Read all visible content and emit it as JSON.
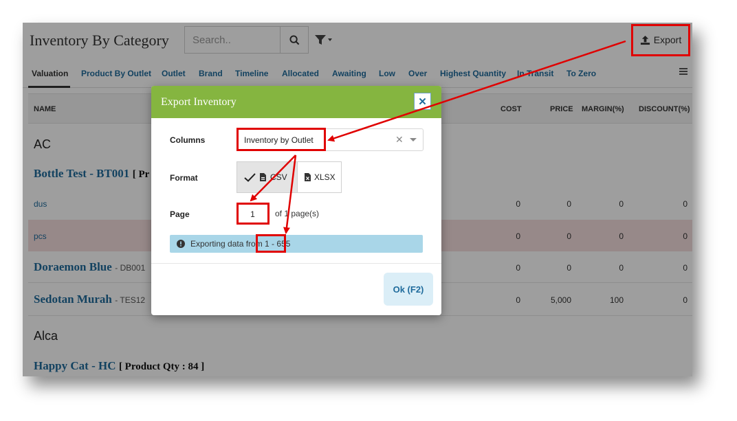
{
  "header": {
    "title": "Inventory By Category",
    "search_placeholder": "Search..",
    "export_label": "Export"
  },
  "tabs": [
    {
      "label": "Valuation",
      "active": true
    },
    {
      "label": "Product By Outlet"
    },
    {
      "label": "Outlet"
    },
    {
      "label": "Brand"
    },
    {
      "label": "Timeline"
    },
    {
      "label": "Allocated"
    },
    {
      "label": "Awaiting"
    },
    {
      "label": "Low"
    },
    {
      "label": "Over"
    },
    {
      "label": "Highest Quantity"
    },
    {
      "label": "In Transit"
    },
    {
      "label": "To Zero"
    }
  ],
  "table": {
    "columns": [
      "NAME",
      "COST",
      "PRICE",
      "MARGIN(%)",
      "DISCOUNT(%)"
    ],
    "groups": [
      {
        "name": "AC",
        "items": [
          {
            "name": "Bottle Test - BT001",
            "qty_partial": "[ Pr"
          },
          {
            "unit": "dus",
            "cost": "0",
            "price": "0",
            "margin": "0",
            "discount": "0"
          },
          {
            "unit": "pcs",
            "cost": "0",
            "price": "0",
            "margin": "0",
            "discount": "0"
          },
          {
            "name": "Doraemon Blue",
            "code": "- DB001",
            "cost": "0",
            "price": "0",
            "margin": "0",
            "discount": "0"
          },
          {
            "name": "Sedotan Murah",
            "code": "- TES12",
            "cost": "0",
            "price": "5,000",
            "margin": "100",
            "discount": "0"
          }
        ]
      },
      {
        "name": "Alca",
        "items": [
          {
            "name": "Happy Cat - HC",
            "qty": "[ Product Qty : 84 ]"
          }
        ]
      }
    ]
  },
  "modal": {
    "title": "Export Inventory",
    "close_label": "✕",
    "columns_label": "Columns",
    "columns_value": "Inventory by Outlet",
    "clear_label": "✕",
    "format_label": "Format",
    "formats": [
      "CSV",
      "XLSX"
    ],
    "selected_format": "CSV",
    "page_label": "Page",
    "page_value": "1",
    "page_of": "of 1 page(s)",
    "info_text": "Exporting data from 1 - 655",
    "ok_label": "Ok (F2)"
  },
  "colors": {
    "modal_header": "#85b540",
    "link": "#1f6b9c",
    "info_bg": "#a9d6e8",
    "annotation": "#e00000"
  }
}
